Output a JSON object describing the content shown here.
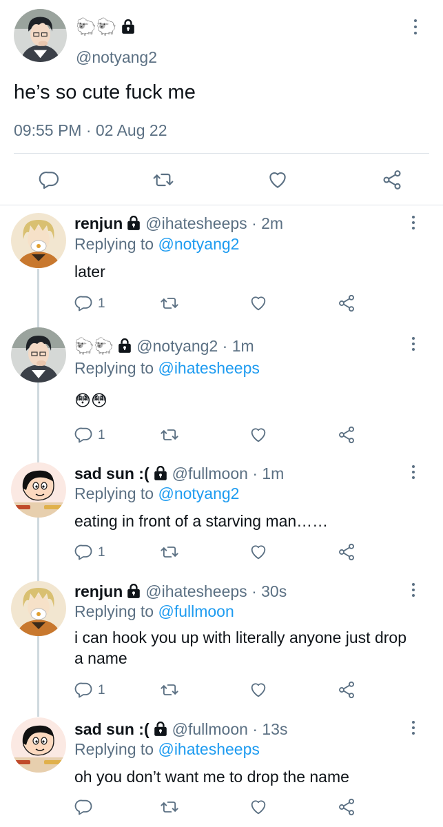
{
  "main_tweet": {
    "display_name": "🐑🐑",
    "handle": "@notyang2",
    "text": "he’s so cute fuck me",
    "timestamp": "09:55 PM · 02 Aug 22",
    "avatar_icon": "anime-boy-avatar",
    "actions": [
      "reply-icon",
      "retweet-icon",
      "like-icon",
      "share-icon"
    ]
  },
  "colors": {
    "secondary_text": "#5b7083",
    "mention_link": "#1d9bf0",
    "thread_line": "#cfd9de",
    "divider": "#dde3e8"
  },
  "replies": [
    {
      "name": "renjun",
      "handle": "@ihatesheeps",
      "time": "· 2m",
      "replying_label": "Replying to",
      "replying_to": "@notyang2",
      "text": "later",
      "reply_count": "1",
      "avatar_icon": "masked-blonde-avatar"
    },
    {
      "name": "🐑🐑",
      "handle": "@notyang2",
      "time": "· 1m",
      "replying_label": "Replying to",
      "replying_to": "@ihatesheeps",
      "text": "😳😳",
      "reply_count": "1",
      "avatar_icon": "anime-boy-avatar"
    },
    {
      "name": "sad sun :(",
      "handle": "@fullmoon",
      "time": "· 1m",
      "replying_label": "Replying to",
      "replying_to": "@notyang2",
      "text": "eating in front of a starving man……",
      "reply_count": "1",
      "avatar_icon": "cartoon-kid-avatar"
    },
    {
      "name": "renjun",
      "handle": "@ihatesheeps",
      "time": "· 30s",
      "replying_label": "Replying to",
      "replying_to": "@fullmoon",
      "text": "i can hook you up with literally anyone just drop a name",
      "reply_count": "1",
      "avatar_icon": "masked-blonde-avatar"
    },
    {
      "name": "sad sun :(",
      "handle": "@fullmoon",
      "time": "· 13s",
      "replying_label": "Replying to",
      "replying_to": "@ihatesheeps",
      "text": "oh you don’t want me to drop the name",
      "reply_count": "",
      "avatar_icon": "cartoon-kid-avatar"
    }
  ]
}
